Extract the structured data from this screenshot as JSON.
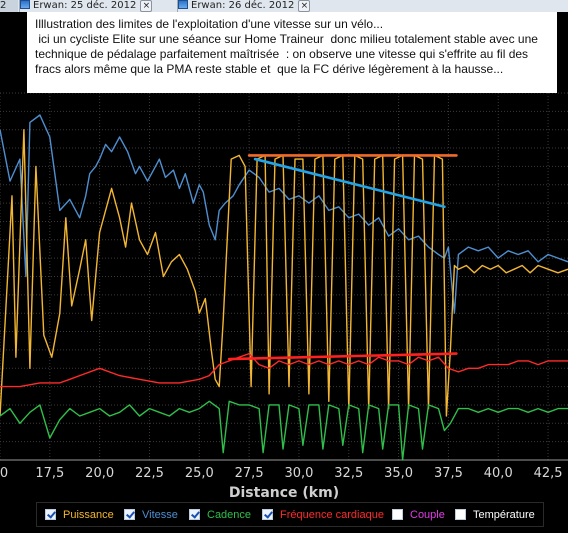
{
  "tabs": [
    {
      "label": "Erwan: 25 déc. 2012"
    },
    {
      "label": "Erwan: 26 déc. 2012"
    }
  ],
  "left_stub": "2",
  "annotation": {
    "lines": [
      "Illlustration des limites de l'exploitation d'une vitesse sur un vélo...",
      " ici un cycliste Elite sur une séance sur Home Traineur  donc milieu totalement stable avec une",
      "technique de pédalage parfaitement maîtrisée  : on observe une vitesse qui s'effrite au fil des",
      "fracs alors même que la PMA reste stable et  que la FC dérive légèrement à la hausse..."
    ]
  },
  "legend": [
    {
      "label": "Puissance",
      "color": "#f2b632",
      "checked": true
    },
    {
      "label": "Vitesse",
      "color": "#4f8fd0",
      "checked": true
    },
    {
      "label": "Cadence",
      "color": "#2fbf4a",
      "checked": true
    },
    {
      "label": "Fréquence cardiaque",
      "color": "#ff2a2a",
      "checked": true
    },
    {
      "label": "Couple",
      "color": "#e23ce6",
      "checked": false
    },
    {
      "label": "Température",
      "color": "#ffffff",
      "checked": false
    }
  ],
  "chart_data": {
    "type": "line",
    "xlabel": "Distance (km)",
    "xlim": [
      15,
      43.5
    ],
    "x_ticks": [
      "20,0",
      "22,5",
      "25,0",
      "27,5",
      "30,0",
      "32,5",
      "35,0",
      "37,5",
      "40,0",
      "42,5"
    ],
    "x_tick_values": [
      20,
      22.5,
      25,
      27.5,
      30,
      32.5,
      35,
      37.5,
      40,
      42.5
    ],
    "x_ticks_partial": [
      "0",
      "17,5"
    ],
    "x_ticks_partial_values": [
      15,
      17.5
    ],
    "ylim": [
      0,
      100
    ],
    "grid": true,
    "legend_position": "bottom",
    "series": [
      {
        "name": "Vitesse",
        "color": "#4f8fd0",
        "x": [
          15,
          15.5,
          16,
          16.3,
          16.5,
          17,
          17.5,
          18,
          18.5,
          19,
          19.3,
          19.5,
          19.8,
          20,
          20.3,
          20.6,
          21,
          21.4,
          21.8,
          22,
          22.4,
          22.8,
          23,
          23.3,
          23.7,
          24,
          24.3,
          24.7,
          25,
          25.2,
          25.5,
          25.8,
          26,
          26.3,
          26.7,
          27,
          27.5,
          28,
          28.5,
          29,
          29.5,
          30,
          30.5,
          31,
          31.5,
          32,
          32.5,
          33,
          33.5,
          34,
          34.5,
          35,
          35.5,
          36,
          36.5,
          37,
          37.3,
          37.5,
          37.8,
          38,
          38.5,
          39,
          39.5,
          40,
          40.5,
          41,
          41.5,
          42,
          42.5,
          43,
          43.5
        ],
        "values": [
          90,
          76,
          82,
          50,
          92,
          94,
          88,
          68,
          71,
          66,
          72,
          78,
          80,
          82,
          86,
          84,
          88,
          84,
          78,
          80,
          76,
          80,
          82,
          77,
          79,
          74,
          78,
          70,
          75,
          73,
          64,
          60,
          68,
          70,
          72,
          75,
          79,
          77,
          73,
          74,
          71,
          72,
          70,
          72,
          68,
          69,
          66,
          67,
          64,
          66,
          61,
          63,
          60,
          61,
          58,
          56,
          55,
          58,
          40,
          56,
          58,
          57,
          58,
          55,
          57,
          56,
          57,
          54,
          56,
          55,
          54
        ]
      },
      {
        "name": "Puissance",
        "color": "#f2b632",
        "x": [
          15,
          15.6,
          15.8,
          16.2,
          16.5,
          16.8,
          17.2,
          17.6,
          18,
          18.3,
          18.6,
          19,
          19.3,
          19.6,
          20,
          20.3,
          20.6,
          21,
          21.3,
          21.6,
          22,
          22.4,
          22.8,
          23.2,
          23.6,
          24,
          24.4,
          24.8,
          25,
          25.3,
          25.6,
          25.8,
          26,
          26.2,
          26.6,
          27,
          27.3,
          27.6,
          27.9,
          28.3,
          28.5,
          28.8,
          29.2,
          29.5,
          29.8,
          30.2,
          30.5,
          30.8,
          31.2,
          31.5,
          31.8,
          32.2,
          32.5,
          32.8,
          33.2,
          33.5,
          33.8,
          34.2,
          34.5,
          34.8,
          35.2,
          35.5,
          35.8,
          36.2,
          36.5,
          36.8,
          37.2,
          37.4,
          37.6,
          37.8,
          38,
          38.4,
          38.8,
          39.2,
          39.6,
          40,
          40.4,
          40.8,
          41.2,
          41.6,
          42,
          42.5,
          43,
          43.5
        ],
        "values": [
          12,
          72,
          28,
          90,
          25,
          80,
          34,
          28,
          40,
          66,
          42,
          52,
          60,
          38,
          62,
          68,
          74,
          66,
          58,
          70,
          60,
          56,
          62,
          50,
          54,
          56,
          52,
          46,
          40,
          44,
          30,
          22,
          20,
          38,
          82,
          83,
          80,
          20,
          82,
          83,
          18,
          82,
          83,
          20,
          82,
          82,
          18,
          82,
          83,
          16,
          82,
          83,
          14,
          83,
          82,
          14,
          82,
          83,
          14,
          82,
          83,
          14,
          83,
          82,
          14,
          83,
          82,
          12,
          30,
          53,
          52,
          53,
          51,
          53,
          52,
          53,
          51,
          52,
          53,
          51,
          53,
          52,
          51,
          52
        ]
      },
      {
        "name": "Fréquence cardiaque",
        "color": "#ff2a2a",
        "x": [
          15,
          16,
          17,
          18,
          18.5,
          19,
          20,
          21,
          22,
          23,
          24,
          25,
          25.5,
          26,
          26.5,
          27,
          27.5,
          28,
          28.5,
          29,
          29.5,
          30,
          30.5,
          31,
          31.5,
          32,
          32.5,
          33,
          33.5,
          34,
          34.5,
          35,
          35.5,
          36,
          36.5,
          37,
          37.5,
          38,
          38.5,
          39,
          39.5,
          40,
          40.5,
          41,
          41.5,
          42,
          42.5,
          43,
          43.5
        ],
        "values": [
          20,
          20,
          21,
          21,
          22,
          23,
          25,
          23,
          22,
          21,
          21,
          22,
          23,
          26,
          27,
          28,
          29,
          26,
          25,
          27,
          26,
          27,
          26,
          27,
          26,
          27,
          26,
          27,
          26,
          28,
          27,
          27,
          26,
          28,
          27,
          28,
          25,
          24,
          25,
          25,
          26,
          26,
          26,
          27,
          27,
          26,
          27,
          27,
          27
        ]
      },
      {
        "name": "Cadence",
        "color": "#2fbf4a",
        "x": [
          15,
          15.5,
          16,
          16.5,
          17,
          17.5,
          18,
          18.5,
          19,
          19.5,
          20,
          20.5,
          21,
          21.5,
          22,
          22.5,
          23,
          23.5,
          24,
          24.5,
          25,
          25.5,
          26,
          26.2,
          26.5,
          27,
          27.5,
          28,
          28.2,
          28.5,
          29,
          29.2,
          29.5,
          30,
          30.2,
          30.5,
          31,
          31.2,
          31.5,
          32,
          32.2,
          32.5,
          33,
          33.2,
          33.5,
          34,
          34.2,
          34.5,
          35,
          35.2,
          35.5,
          36,
          36.2,
          36.5,
          37,
          37.3,
          37.6,
          38,
          38.5,
          39,
          39.5,
          40,
          40.5,
          41,
          41.5,
          42,
          42.5,
          43,
          43.5
        ],
        "values": [
          12,
          14,
          10,
          13,
          15,
          6,
          11,
          14,
          12,
          13,
          14,
          12,
          13,
          15,
          12,
          14,
          13,
          12,
          14,
          13,
          14,
          16,
          14,
          2,
          16,
          15,
          15,
          14,
          2,
          15,
          15,
          3,
          15,
          14,
          4,
          15,
          15,
          3,
          15,
          14,
          4,
          15,
          14,
          2,
          15,
          14,
          3,
          15,
          15,
          0,
          15,
          14,
          3,
          15,
          14,
          8,
          10,
          14,
          14,
          13,
          14,
          13,
          14,
          14,
          13,
          14,
          13,
          14,
          14
        ]
      }
    ],
    "annotation_lines": [
      {
        "label": "PMA",
        "color": "#f26a2a",
        "x": [
          27.5,
          37.9
        ],
        "y": [
          83,
          83
        ]
      },
      {
        "label": "Vitesse trend",
        "color": "#22a5e8",
        "x": [
          27.8,
          37.3
        ],
        "y": [
          82,
          69
        ]
      },
      {
        "label": "FC trend",
        "color": "#ff2020",
        "x": [
          26.5,
          37.9
        ],
        "y": [
          27.5,
          29
        ]
      }
    ]
  }
}
